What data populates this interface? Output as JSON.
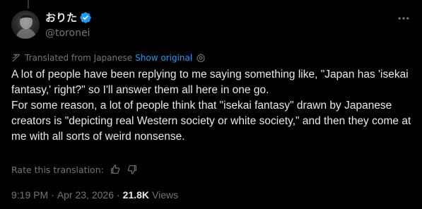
{
  "author": {
    "display_name": "おりた",
    "handle": "@toronei",
    "verified_color": "#1d9bf0"
  },
  "translation": {
    "label": "Translated from Japanese",
    "show_original": "Show original"
  },
  "post": {
    "text": "A lot of people have been replying to me saying something like, \"Japan has 'isekai fantasy,' right?\" so I'll answer them all here in one go.\nFor some reason, a lot of people think that \"isekai fantasy\" drawn by Japanese creators is \"depicting real Western society or white society,\" and then they come at me with all sorts of weird nonsense."
  },
  "rating": {
    "label": "Rate this translation:"
  },
  "meta": {
    "time": "9:19 PM",
    "date": "Apr 23, 2026",
    "separator": "·",
    "views_count": "21.8K",
    "views_label": "Views"
  },
  "icons": {
    "more": "more-horizontal-icon",
    "translate": "translate-icon",
    "settings": "gear-icon",
    "thumbs_up": "thumbs-up-icon",
    "thumbs_down": "thumbs-down-icon"
  }
}
